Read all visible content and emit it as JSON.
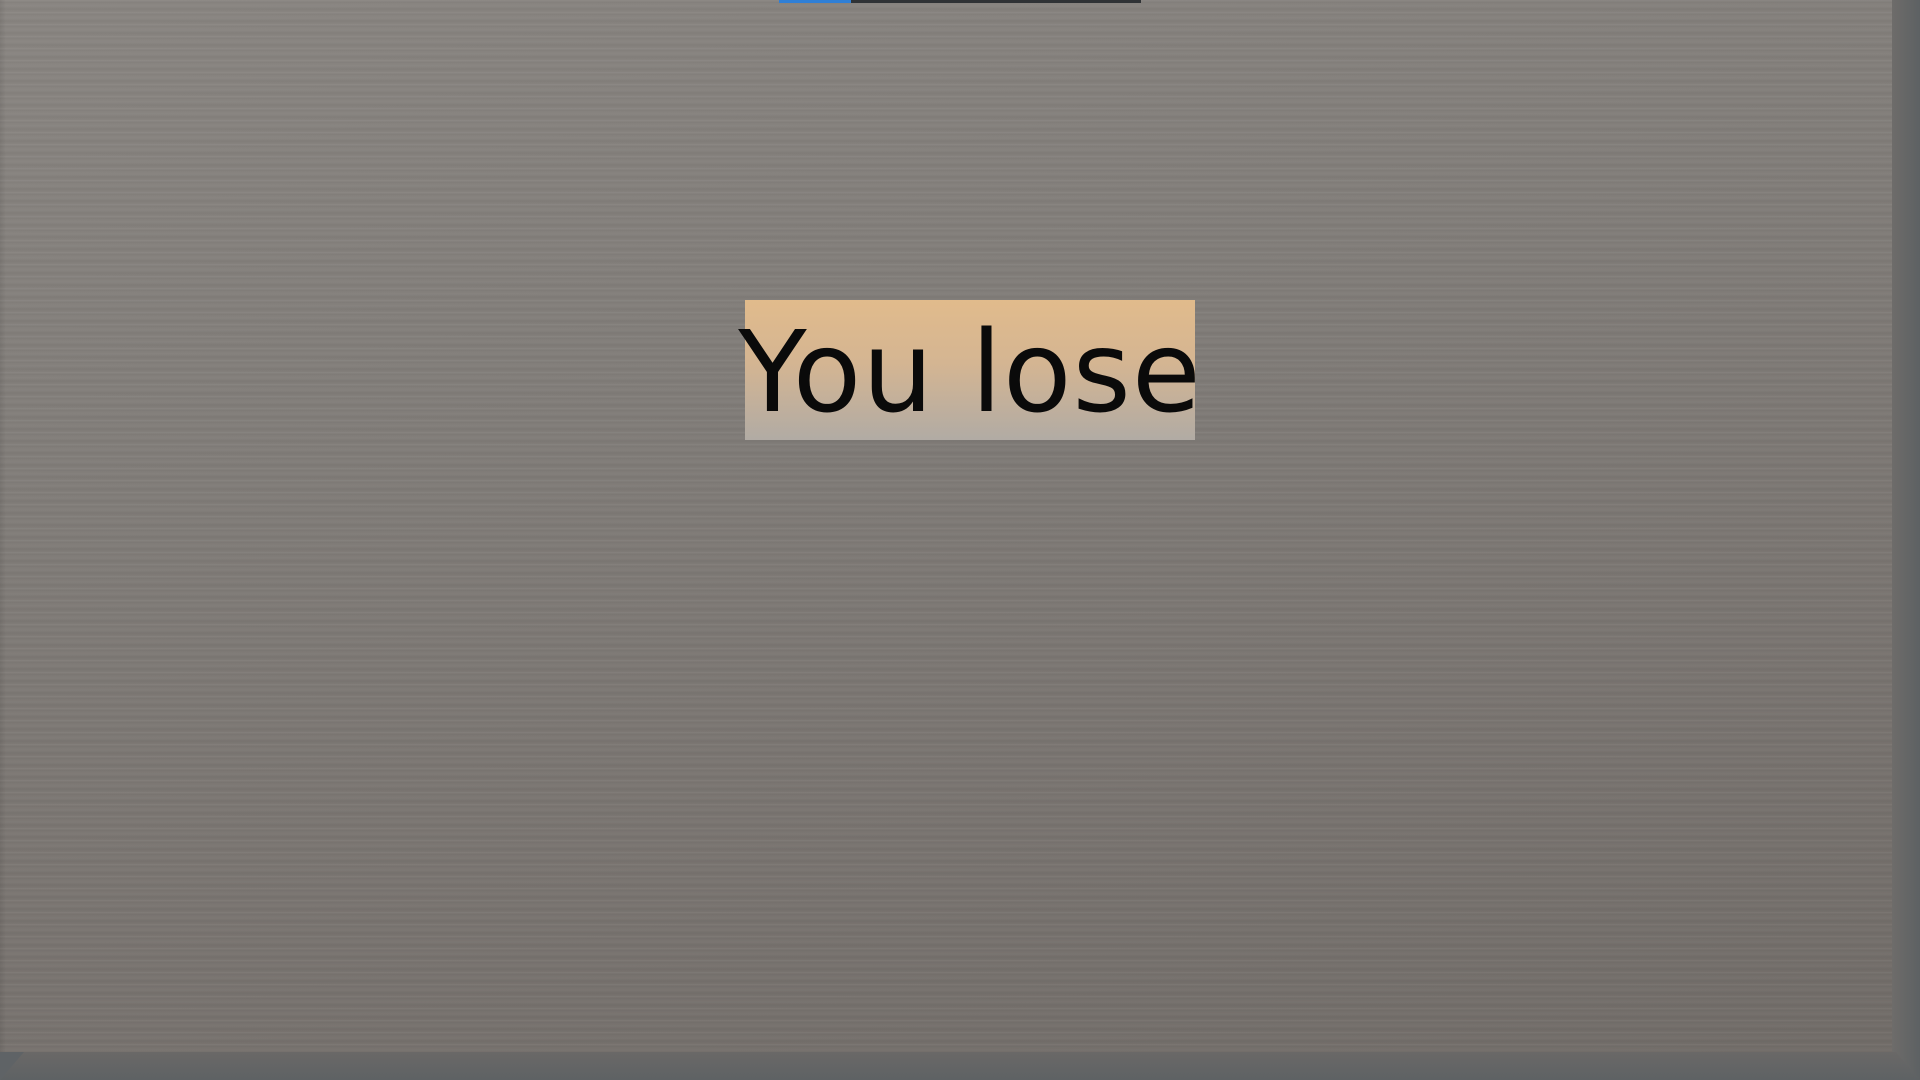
{
  "game": {
    "result_message": "You lose"
  },
  "progress": {
    "fill_fraction": 0.2,
    "fill_color": "#2f7fd6",
    "track_color": "#2f3235"
  },
  "colors": {
    "board": "#827e7a",
    "banner_top": "#e1bb8c",
    "banner_bottom": "#b1aba4",
    "text": "#0a0a0a"
  }
}
